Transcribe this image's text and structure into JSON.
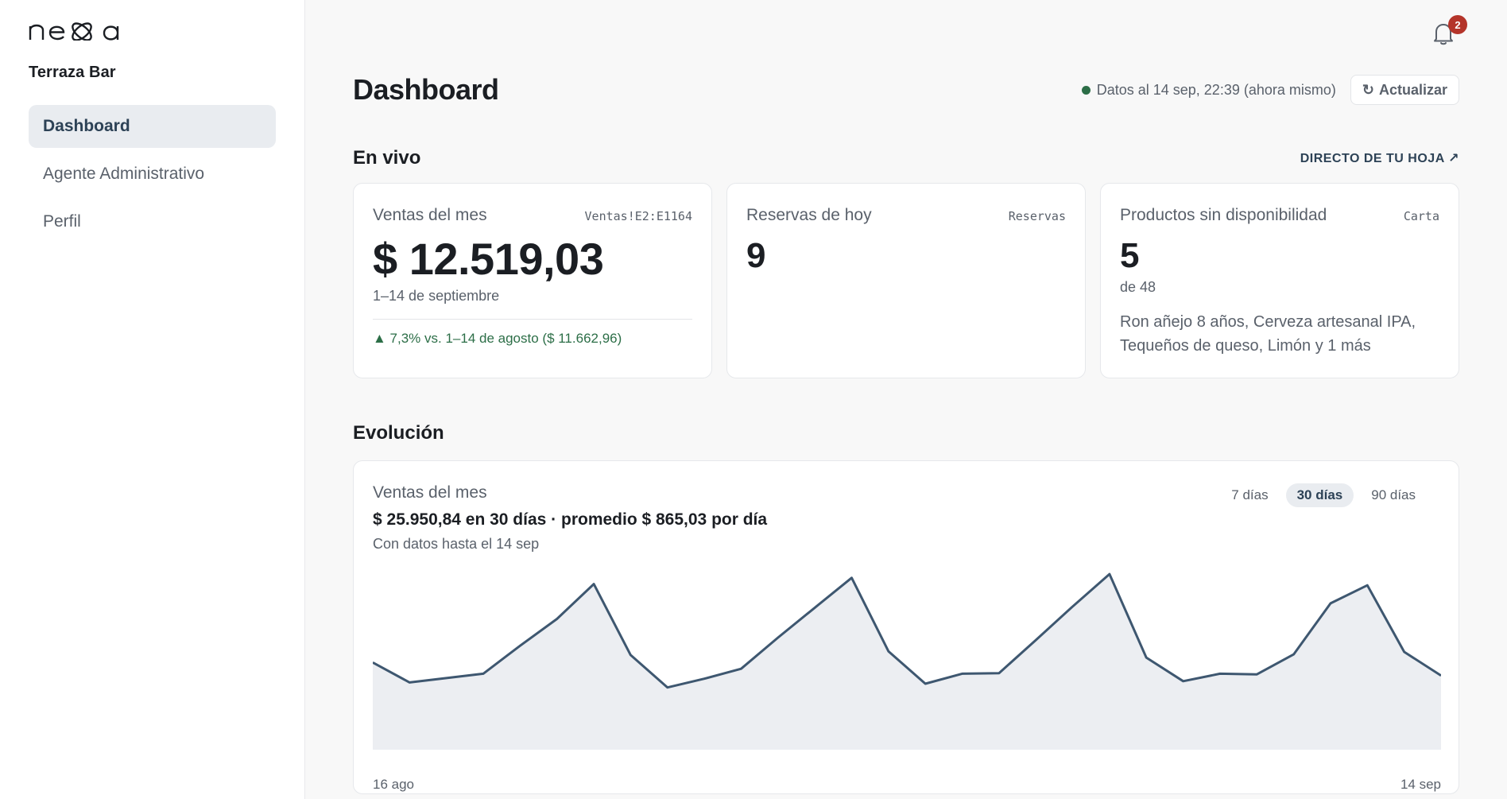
{
  "brand": {
    "logo": "nexa",
    "business_name": "Terraza Bar"
  },
  "sidebar": {
    "items": [
      {
        "label": "Dashboard",
        "active": true
      },
      {
        "label": "Agente Administrativo",
        "active": false
      },
      {
        "label": "Perfil",
        "active": false
      }
    ]
  },
  "notifications": {
    "icon": "bell-icon",
    "count": "2",
    "badge_color": "#b4342a"
  },
  "header": {
    "title": "Dashboard",
    "status_text": "Datos al 14 sep, 22:39 (ahora mismo)",
    "status_color": "#2c6e47",
    "refresh_icon": "refresh-icon",
    "refresh_label": "Actualizar"
  },
  "live": {
    "title": "En vivo",
    "link": "DIRECTO DE TU HOJA ↗",
    "cards": [
      {
        "title": "Ventas del mes",
        "source": "Ventas!E2:E1164",
        "value": "$ 12.519,03",
        "period": "1–14 de septiembre",
        "trend": "▲ 7,3% vs. 1–14 de agosto ($ 11.662,96)"
      },
      {
        "title": "Reservas de hoy",
        "source": "Reservas",
        "value": "9"
      },
      {
        "title": "Productos sin disponibilidad",
        "source": "Carta",
        "value": "5",
        "total": "de 48",
        "items": "Ron añejo 8 años, Cerveza artesanal IPA, Tequeños de queso, Limón y 1 más"
      }
    ]
  },
  "evolution": {
    "title": "Evolución",
    "card_title": "Ventas del mes",
    "ranges": [
      {
        "label": "7 días",
        "active": false
      },
      {
        "label": "30 días",
        "active": true
      },
      {
        "label": "90 días",
        "active": false
      }
    ],
    "summary": "$ 25.950,84 en 30 días · promedio $ 865,03 por día",
    "note": "Con datos hasta el 14 sep"
  },
  "chart_data": {
    "type": "area",
    "x_start_label": "16 ago",
    "x_end_label": "14 sep",
    "values": [
      700,
      540,
      575,
      610,
      835,
      1050,
      1330,
      760,
      500,
      570,
      650,
      900,
      1140,
      1380,
      790,
      530,
      610,
      615,
      880,
      1150,
      1410,
      740,
      550,
      610,
      605,
      765,
      1175,
      1320,
      785,
      595
    ],
    "ylim": [
      0,
      1500
    ],
    "line_color": "#3e5770",
    "fill_color": "#eceef2",
    "grid": false,
    "legend": "none"
  }
}
